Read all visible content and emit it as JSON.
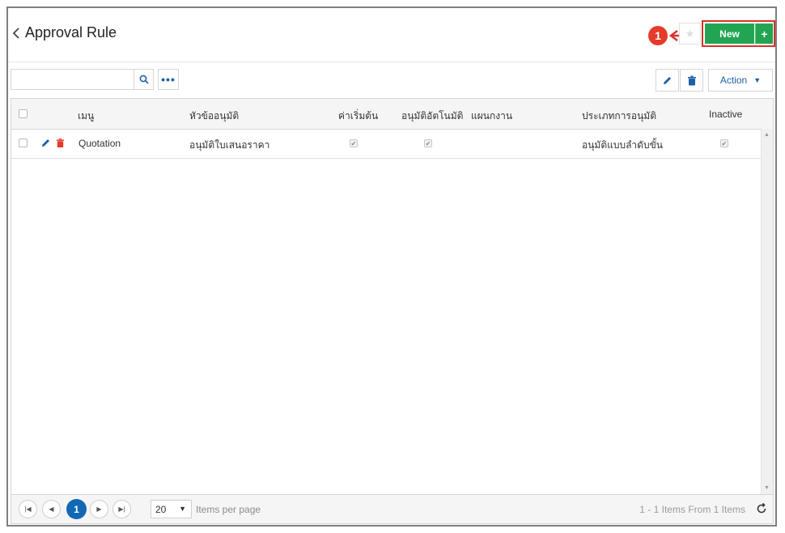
{
  "header": {
    "title": "Approval Rule",
    "new_label": "New",
    "plus_label": "+",
    "step_number": "1"
  },
  "toolbar": {
    "search_placeholder": "",
    "more_label": "•••",
    "action_label": "Action"
  },
  "grid": {
    "columns": [
      "เมนู",
      "หัวข้ออนุมัติ",
      "ค่าเริ่มต้น",
      "อนุมัติอัตโนมัติ",
      "แผนกงาน",
      "ประเภทการอนุมัติ",
      "Inactive"
    ],
    "rows": [
      {
        "menu": "Quotation",
        "subject": "อนุมัติใบเสนอราคา",
        "default": true,
        "auto_approve": true,
        "department": "",
        "approval_type": "อนุมัติแบบลำดับขั้น",
        "inactive": true
      }
    ]
  },
  "pager": {
    "current_page": "1",
    "page_size": "20",
    "per_page_label": "Items per page",
    "info": "1 - 1 Items From 1 Items"
  },
  "colors": {
    "accent": "#1268b3",
    "new_button": "#22a553",
    "delete": "#e53b2a",
    "highlight": "#d9322b"
  }
}
